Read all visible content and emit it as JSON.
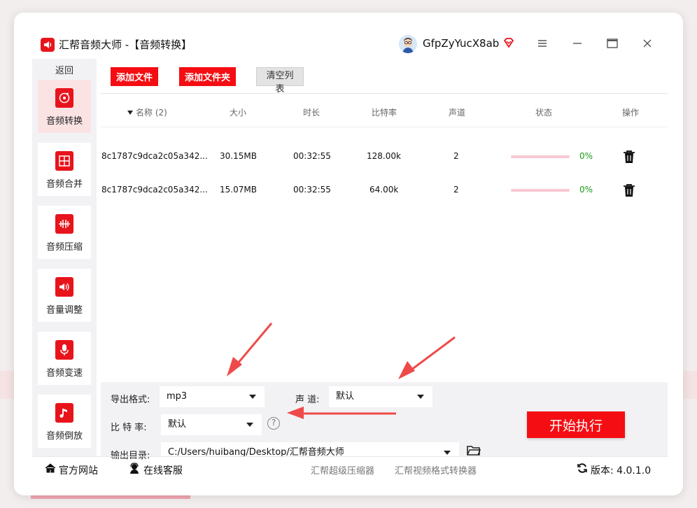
{
  "app": {
    "title": "汇帮音频大师  -【音频转换】",
    "username": "GfpZyYucX8ab"
  },
  "sidebar": {
    "back_label": "返回",
    "items": [
      {
        "label": "音频转换",
        "icon": "audio-convert-icon",
        "active": true
      },
      {
        "label": "音频合并",
        "icon": "audio-merge-icon",
        "active": false
      },
      {
        "label": "音频压缩",
        "icon": "audio-compress-icon",
        "active": false
      },
      {
        "label": "音量调整",
        "icon": "volume-icon",
        "active": false
      },
      {
        "label": "音频变速",
        "icon": "microphone-icon",
        "active": false
      },
      {
        "label": "音频倒放",
        "icon": "music-note-icon",
        "active": false
      }
    ]
  },
  "toolbar": {
    "add_file": "添加文件",
    "add_folder": "添加文件夹",
    "clear_list": "清空列表"
  },
  "table": {
    "headers": {
      "name": "名称 (2)",
      "size": "大小",
      "duration": "时长",
      "bitrate": "比特率",
      "channels": "声道",
      "status": "状态",
      "action": "操作"
    },
    "rows": [
      {
        "name": "8c1787c9dca2c05a342...",
        "size": "30.15MB",
        "duration": "00:32:55",
        "bitrate": "128.00k",
        "channels": "2",
        "progress": "0%"
      },
      {
        "name": "8c1787c9dca2c05a342...",
        "size": "15.07MB",
        "duration": "00:32:55",
        "bitrate": "64.00k",
        "channels": "2",
        "progress": "0%"
      }
    ]
  },
  "settings": {
    "format_label": "导出格式:",
    "format_value": "mp3",
    "channel_label": "声 道:",
    "channel_value": "默认",
    "bitrate_label": "比 特 率:",
    "bitrate_value": "默认",
    "help": "?",
    "output_label": "输出目录:",
    "output_value": "C:/Users/huibang/Desktop/汇帮音频大师",
    "start_label": "开始执行"
  },
  "footer": {
    "website": "官方网站",
    "support": "在线客服",
    "link1": "汇帮超级压缩器",
    "link2": "汇帮视频格式转换器",
    "version": "版本: 4.0.1.0"
  },
  "colors": {
    "accent": "#f40d12",
    "progress_track": "#f8c8d3",
    "progress_text": "#1a9a1a"
  }
}
